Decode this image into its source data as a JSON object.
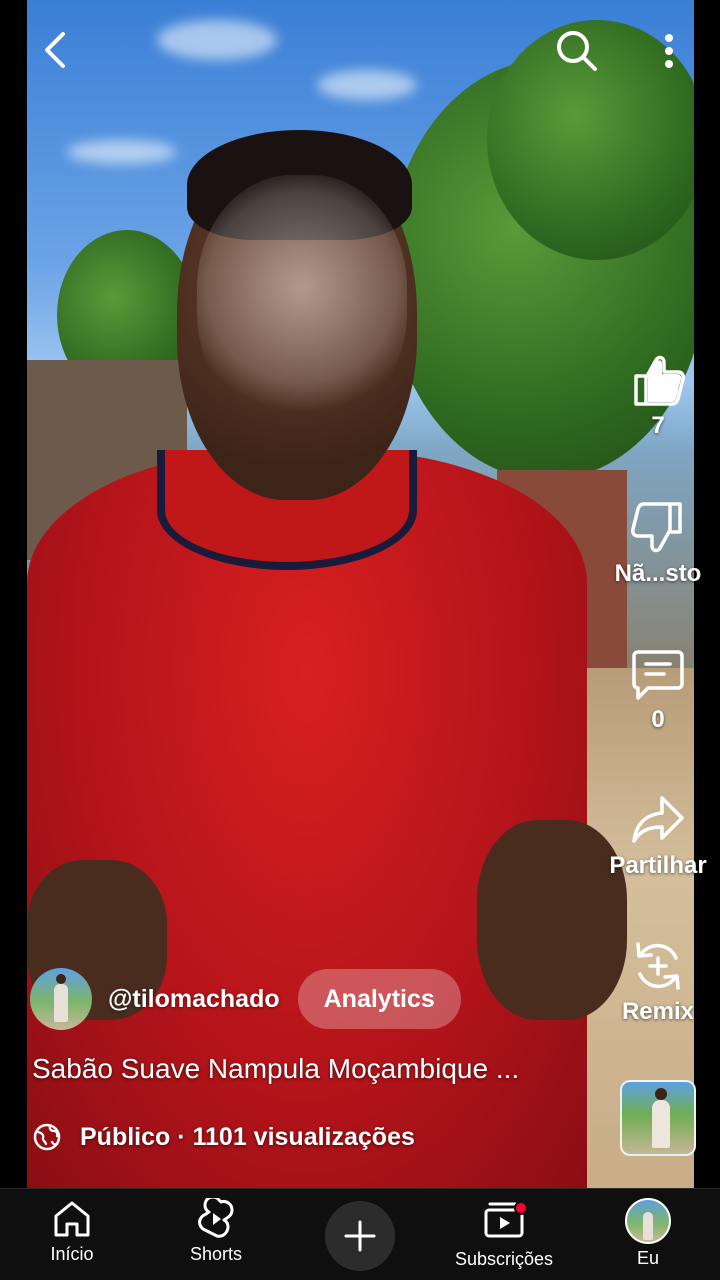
{
  "top_bar": {
    "back_icon": "chevron-left-icon",
    "search_icon": "search-icon",
    "more_icon": "more-vert-icon"
  },
  "actions": {
    "like_count": "7",
    "dislike_label": "Nã...sto",
    "comment_count": "0",
    "share_label": "Partilhar",
    "remix_label": "Remix"
  },
  "video": {
    "channel_handle": "@tilomachado",
    "analytics_label": "Analytics",
    "title": "Sabão Suave Nampula Moçambique ...",
    "meta": "Público · 1101 visualizações"
  },
  "bottom_nav": {
    "home": "Início",
    "shorts": "Shorts",
    "subscriptions": "Subscrições",
    "you": "Eu"
  },
  "colors": {
    "nav_background": "#0f0f0f",
    "notification_dot": "#ff0033",
    "shirt_red": "#d82020"
  }
}
